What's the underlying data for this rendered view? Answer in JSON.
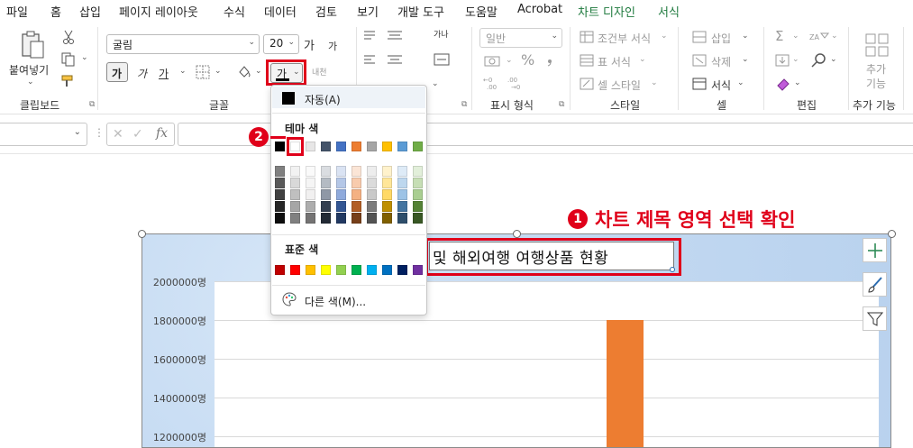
{
  "menu": {
    "tabs": [
      {
        "label": "파일"
      },
      {
        "label": "홈"
      },
      {
        "label": "삽입"
      },
      {
        "label": "페이지 레이아웃"
      },
      {
        "label": "수식"
      },
      {
        "label": "데이터"
      },
      {
        "label": "검토"
      },
      {
        "label": "보기"
      },
      {
        "label": "개발 도구"
      },
      {
        "label": "도움말"
      },
      {
        "label": "Acrobat"
      },
      {
        "label": "차트 디자인"
      },
      {
        "label": "서식"
      }
    ]
  },
  "ribbon": {
    "clipboard": {
      "paste_label": "붙여넣기",
      "group_label": "클립보드"
    },
    "font": {
      "font_name": "굴림",
      "font_size": "20",
      "grow_label": "가",
      "shrink_label": "가",
      "bold_label": "가",
      "italic_label": "가",
      "underline_label": "가",
      "font_color_label": "가",
      "phonetic_label": "내천",
      "group_label": "글꼴"
    },
    "alignment": {
      "wrap_label": "가나"
    },
    "number": {
      "format_value": "일반",
      "percent_label": "%",
      "group_label": "표시 형식"
    },
    "styles": {
      "conditional_label": "조건부 서식",
      "table_label": "표 서식",
      "cell_style_label": "셀 스타일",
      "group_label": "스타일"
    },
    "cells": {
      "insert_label": "삽입",
      "delete_label": "삭제",
      "format_label": "서식",
      "group_label": "셀"
    },
    "editing": {
      "sum_label": "Σ",
      "group_label": "편집"
    },
    "addins": {
      "label1": "추가",
      "label2": "기능",
      "group_label": "추가 기능"
    }
  },
  "formula_bar": {
    "fx_label": "fx"
  },
  "color_popup": {
    "auto_label": "자동(A)",
    "theme_label": "테마 색",
    "standard_label": "표준 색",
    "more_label": "다른 색(M)...",
    "theme_top": [
      "#000000",
      "#ffffff",
      "#e7e6e6",
      "#44546a",
      "#4472c4",
      "#ed7d31",
      "#a5a5a5",
      "#ffc000",
      "#5b9bd5",
      "#70ad47"
    ],
    "standard": [
      "#c00000",
      "#ff0000",
      "#ffc000",
      "#ffff00",
      "#92d050",
      "#00b050",
      "#00b0f0",
      "#0070c0",
      "#002060",
      "#7030a0"
    ]
  },
  "chart": {
    "title_visible": "및 해외여행 여행상품 현황",
    "side_buttons": [
      "plus-icon",
      "brush-icon",
      "filter-icon"
    ]
  },
  "chart_data": {
    "type": "bar",
    "title": "및 해외여행 여행상품 현황",
    "y_tick_labels": [
      "2000000명",
      "1800000명",
      "1600000명",
      "1400000명",
      "1200000명"
    ],
    "ylim_visible": [
      1200000,
      2000000
    ],
    "series": [
      {
        "values": [
          1800000
        ]
      }
    ],
    "colors": [
      "#ed7d31"
    ]
  },
  "annotations": {
    "step1_number": "1",
    "step1_text": "차트 제목 영역 선택 확인",
    "step2_number": "2"
  }
}
